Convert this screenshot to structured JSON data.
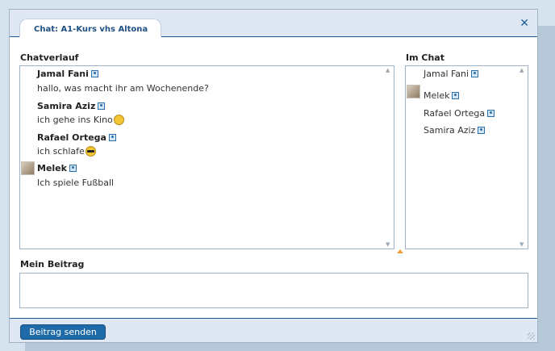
{
  "window": {
    "tab_title": "Chat: A1-Kurs vhs Altona",
    "close_icon": "close-icon"
  },
  "chatverlauf": {
    "label": "Chatverlauf",
    "messages": [
      {
        "name": "Jamal Fani",
        "text": "hallo, was macht ihr am Wochenende?",
        "emoji": "",
        "avatar": false
      },
      {
        "name": "Samira Aziz",
        "text": "ich gehe ins Kino",
        "emoji": "grinning-face",
        "avatar": false
      },
      {
        "name": "Rafael Ortega",
        "text": "ich schlafe",
        "emoji": "sunglasses-face",
        "avatar": false
      },
      {
        "name": "Melek",
        "text": "Ich spiele Fußball",
        "emoji": "",
        "avatar": true
      }
    ]
  },
  "im_chat": {
    "label": "Im Chat",
    "users": [
      {
        "name": "Jamal Fani",
        "avatar": false
      },
      {
        "name": "Melek",
        "avatar": true
      },
      {
        "name": "Rafael Ortega",
        "avatar": false
      },
      {
        "name": "Samira Aziz",
        "avatar": false
      }
    ]
  },
  "mein_beitrag": {
    "label": "Mein Beitrag",
    "value": ""
  },
  "footer": {
    "send_label": "Beitrag senden"
  }
}
